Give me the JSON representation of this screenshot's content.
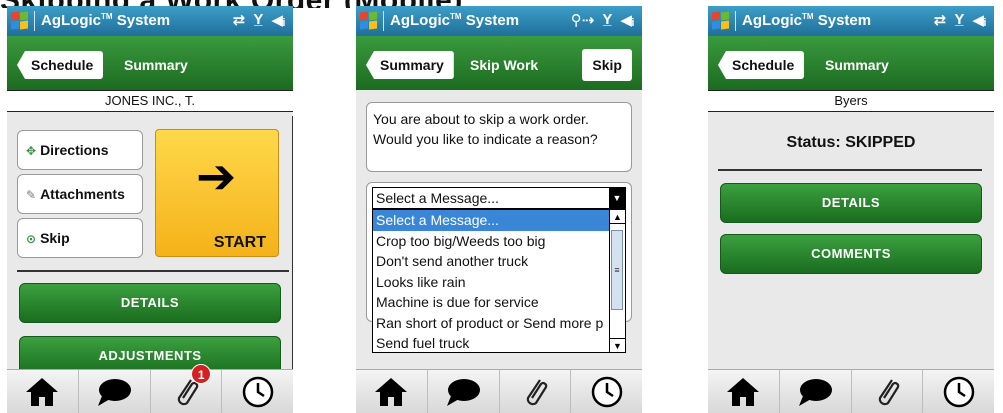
{
  "heading": "Skipping a Work Order (Mobile)",
  "app": {
    "title": "AgLogic",
    "trademark": "TM",
    "title_suffix": " System"
  },
  "colors": {
    "status_bar": "#1f6f99",
    "nav_bar": "#2a8a2e",
    "green_button": "#2b8a2f",
    "start_button": "#f7c12e",
    "badge": "#d42020",
    "dropdown_selected": "#3a86d6"
  },
  "screen1": {
    "status_icons": [
      "sync-icon",
      "signal-icon",
      "volume-icon"
    ],
    "back_button": "Schedule",
    "nav_title": "Summary",
    "customer_name": "JONES INC., T.",
    "buttons": [
      {
        "label": "Directions",
        "icon": "crosshair-icon"
      },
      {
        "label": "Attachments",
        "icon": "paperclip-icon"
      },
      {
        "label": "Skip",
        "icon": "radio-icon"
      }
    ],
    "start_label": "START",
    "details_label": "DETAILS",
    "adjustments_label": "ADJUSTMENTS",
    "attachment_badge": "1"
  },
  "screen2": {
    "status_icons": [
      "sync-person-icon",
      "signal-icon",
      "volume-icon"
    ],
    "back_button": "Summary",
    "nav_title": "Skip Work",
    "right_button": "Skip",
    "prompt": "You are about to skip a work order. Would you like to indicate a reason?",
    "select_value": "Select a Message...",
    "options": [
      "Select a Message...",
      "Crop too big/Weeds too big",
      "Don't send another truck",
      "Looks like rain",
      "Machine is due for service",
      "Ran short of product or Send more p",
      "Send fuel truck"
    ]
  },
  "screen3": {
    "status_icons": [
      "sync-icon",
      "signal-icon",
      "volume-icon"
    ],
    "back_button": "Schedule",
    "nav_title": "Summary",
    "customer_name": "Byers",
    "status_text": "Status: SKIPPED",
    "details_label": "DETAILS",
    "comments_label": "COMMENTS"
  },
  "bottom_nav": [
    "home-icon",
    "chat-icon",
    "paperclip-icon",
    "clock-icon"
  ]
}
